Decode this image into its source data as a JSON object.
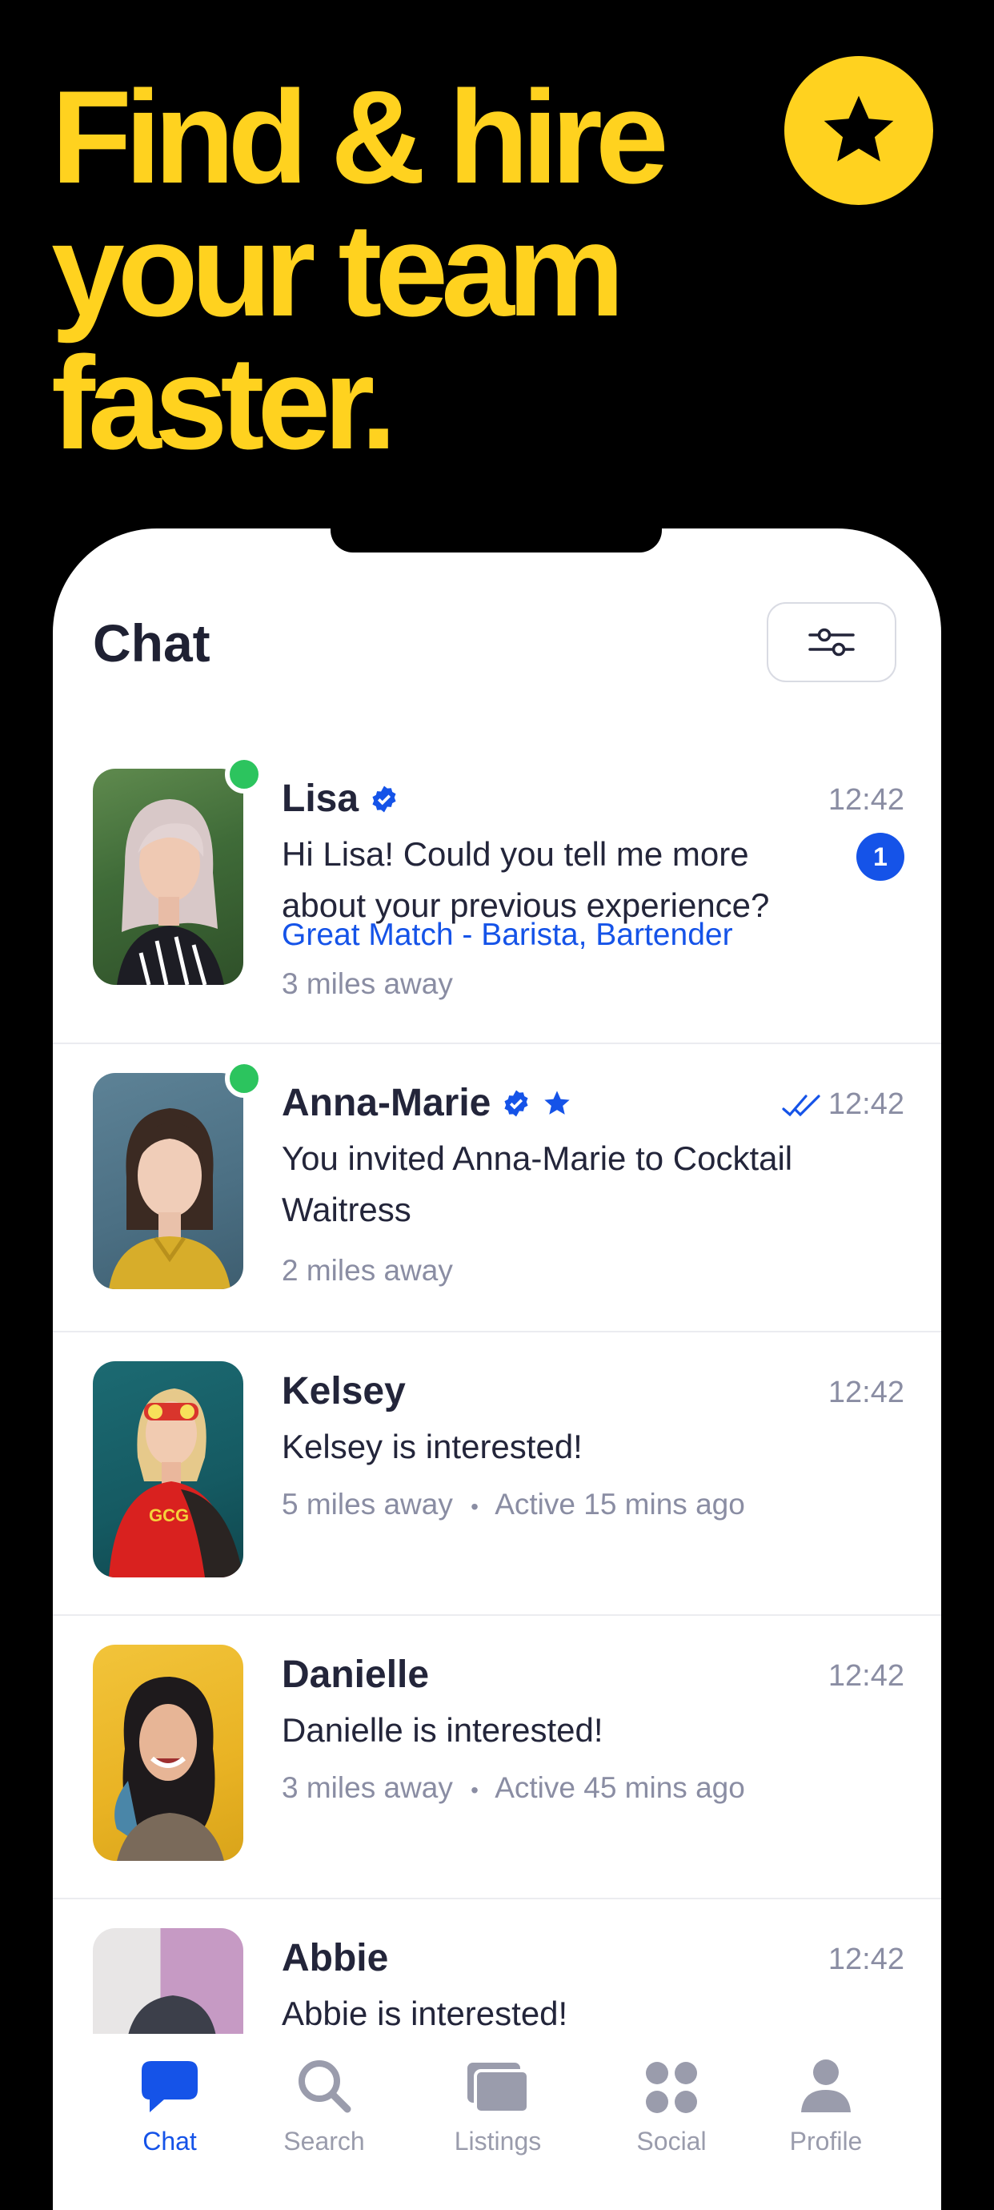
{
  "promo": {
    "headline_line1": "Find & hire",
    "headline_line2": "your team",
    "headline_line3": "faster."
  },
  "colors": {
    "accent_yellow": "#FFD21F",
    "brand_blue": "#1553E8",
    "online_green": "#2CC45E"
  },
  "header": {
    "title": "Chat"
  },
  "chats": [
    {
      "name": "Lisa",
      "verified": true,
      "starred": false,
      "online": true,
      "time": "12:42",
      "read_receipt": false,
      "unread_count": "1",
      "message": "Hi Lisa! Could you tell me more about your previous experience?",
      "match": "Great Match - Barista, Bartender",
      "distance": "3 miles away",
      "active": ""
    },
    {
      "name": "Anna-Marie",
      "verified": true,
      "starred": true,
      "online": true,
      "time": "12:42",
      "read_receipt": true,
      "unread_count": "",
      "message": "You invited Anna-Marie to Cocktail Waitress",
      "match": "",
      "distance": "2 miles away",
      "active": ""
    },
    {
      "name": "Kelsey",
      "verified": false,
      "starred": false,
      "online": false,
      "time": "12:42",
      "read_receipt": false,
      "unread_count": "",
      "message": "Kelsey is interested!",
      "match": "",
      "distance": "5 miles away",
      "separator": "•",
      "active": "Active 15 mins ago"
    },
    {
      "name": "Danielle",
      "verified": false,
      "starred": false,
      "online": false,
      "time": "12:42",
      "read_receipt": false,
      "unread_count": "",
      "message": "Danielle is interested!",
      "match": "",
      "distance": "3 miles away",
      "separator": "•",
      "active": "Active 45 mins ago"
    },
    {
      "name": "Abbie",
      "verified": false,
      "starred": false,
      "online": false,
      "time": "12:42",
      "read_receipt": false,
      "unread_count": "",
      "message": "Abbie is interested!",
      "match": "",
      "distance": "",
      "active": ""
    }
  ],
  "tabs": [
    {
      "label": "Chat",
      "icon": "chat-bubble-icon",
      "active": true
    },
    {
      "label": "Search",
      "icon": "search-icon",
      "active": false
    },
    {
      "label": "Listings",
      "icon": "listings-icon",
      "active": false
    },
    {
      "label": "Social",
      "icon": "social-grid-icon",
      "active": false
    },
    {
      "label": "Profile",
      "icon": "profile-icon",
      "active": false
    }
  ]
}
